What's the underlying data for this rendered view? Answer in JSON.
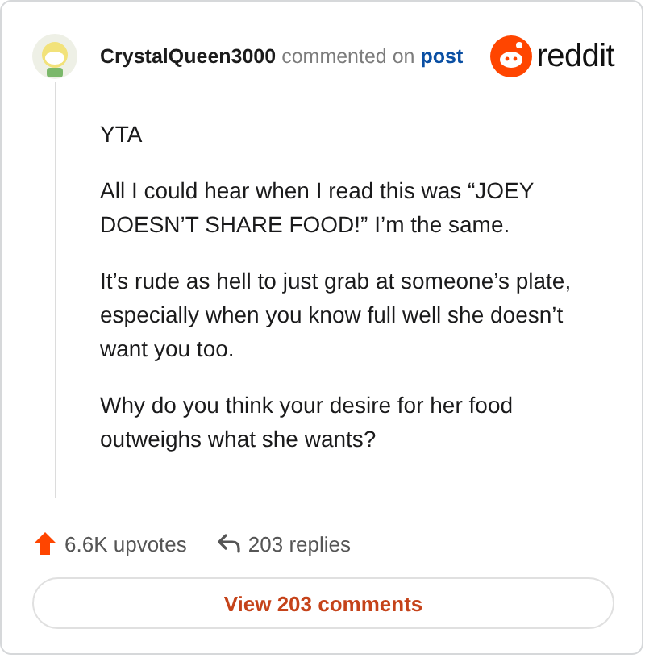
{
  "header": {
    "username": "CrystalQueen3000",
    "action": "commented on",
    "link": "post",
    "brand": "reddit"
  },
  "paragraphs": [
    "YTA",
    "All I could hear when I read this was “JOEY DOESN’T SHARE FOOD!” I’m the same.",
    "It’s rude as hell to just grab at someone’s plate, especially when you know full well she doesn’t want you too.",
    "Why do you think your desire for her food outweighs what she wants?"
  ],
  "footer": {
    "upvotes": "6.6K upvotes",
    "replies": "203 replies",
    "button": "View 203 comments"
  }
}
